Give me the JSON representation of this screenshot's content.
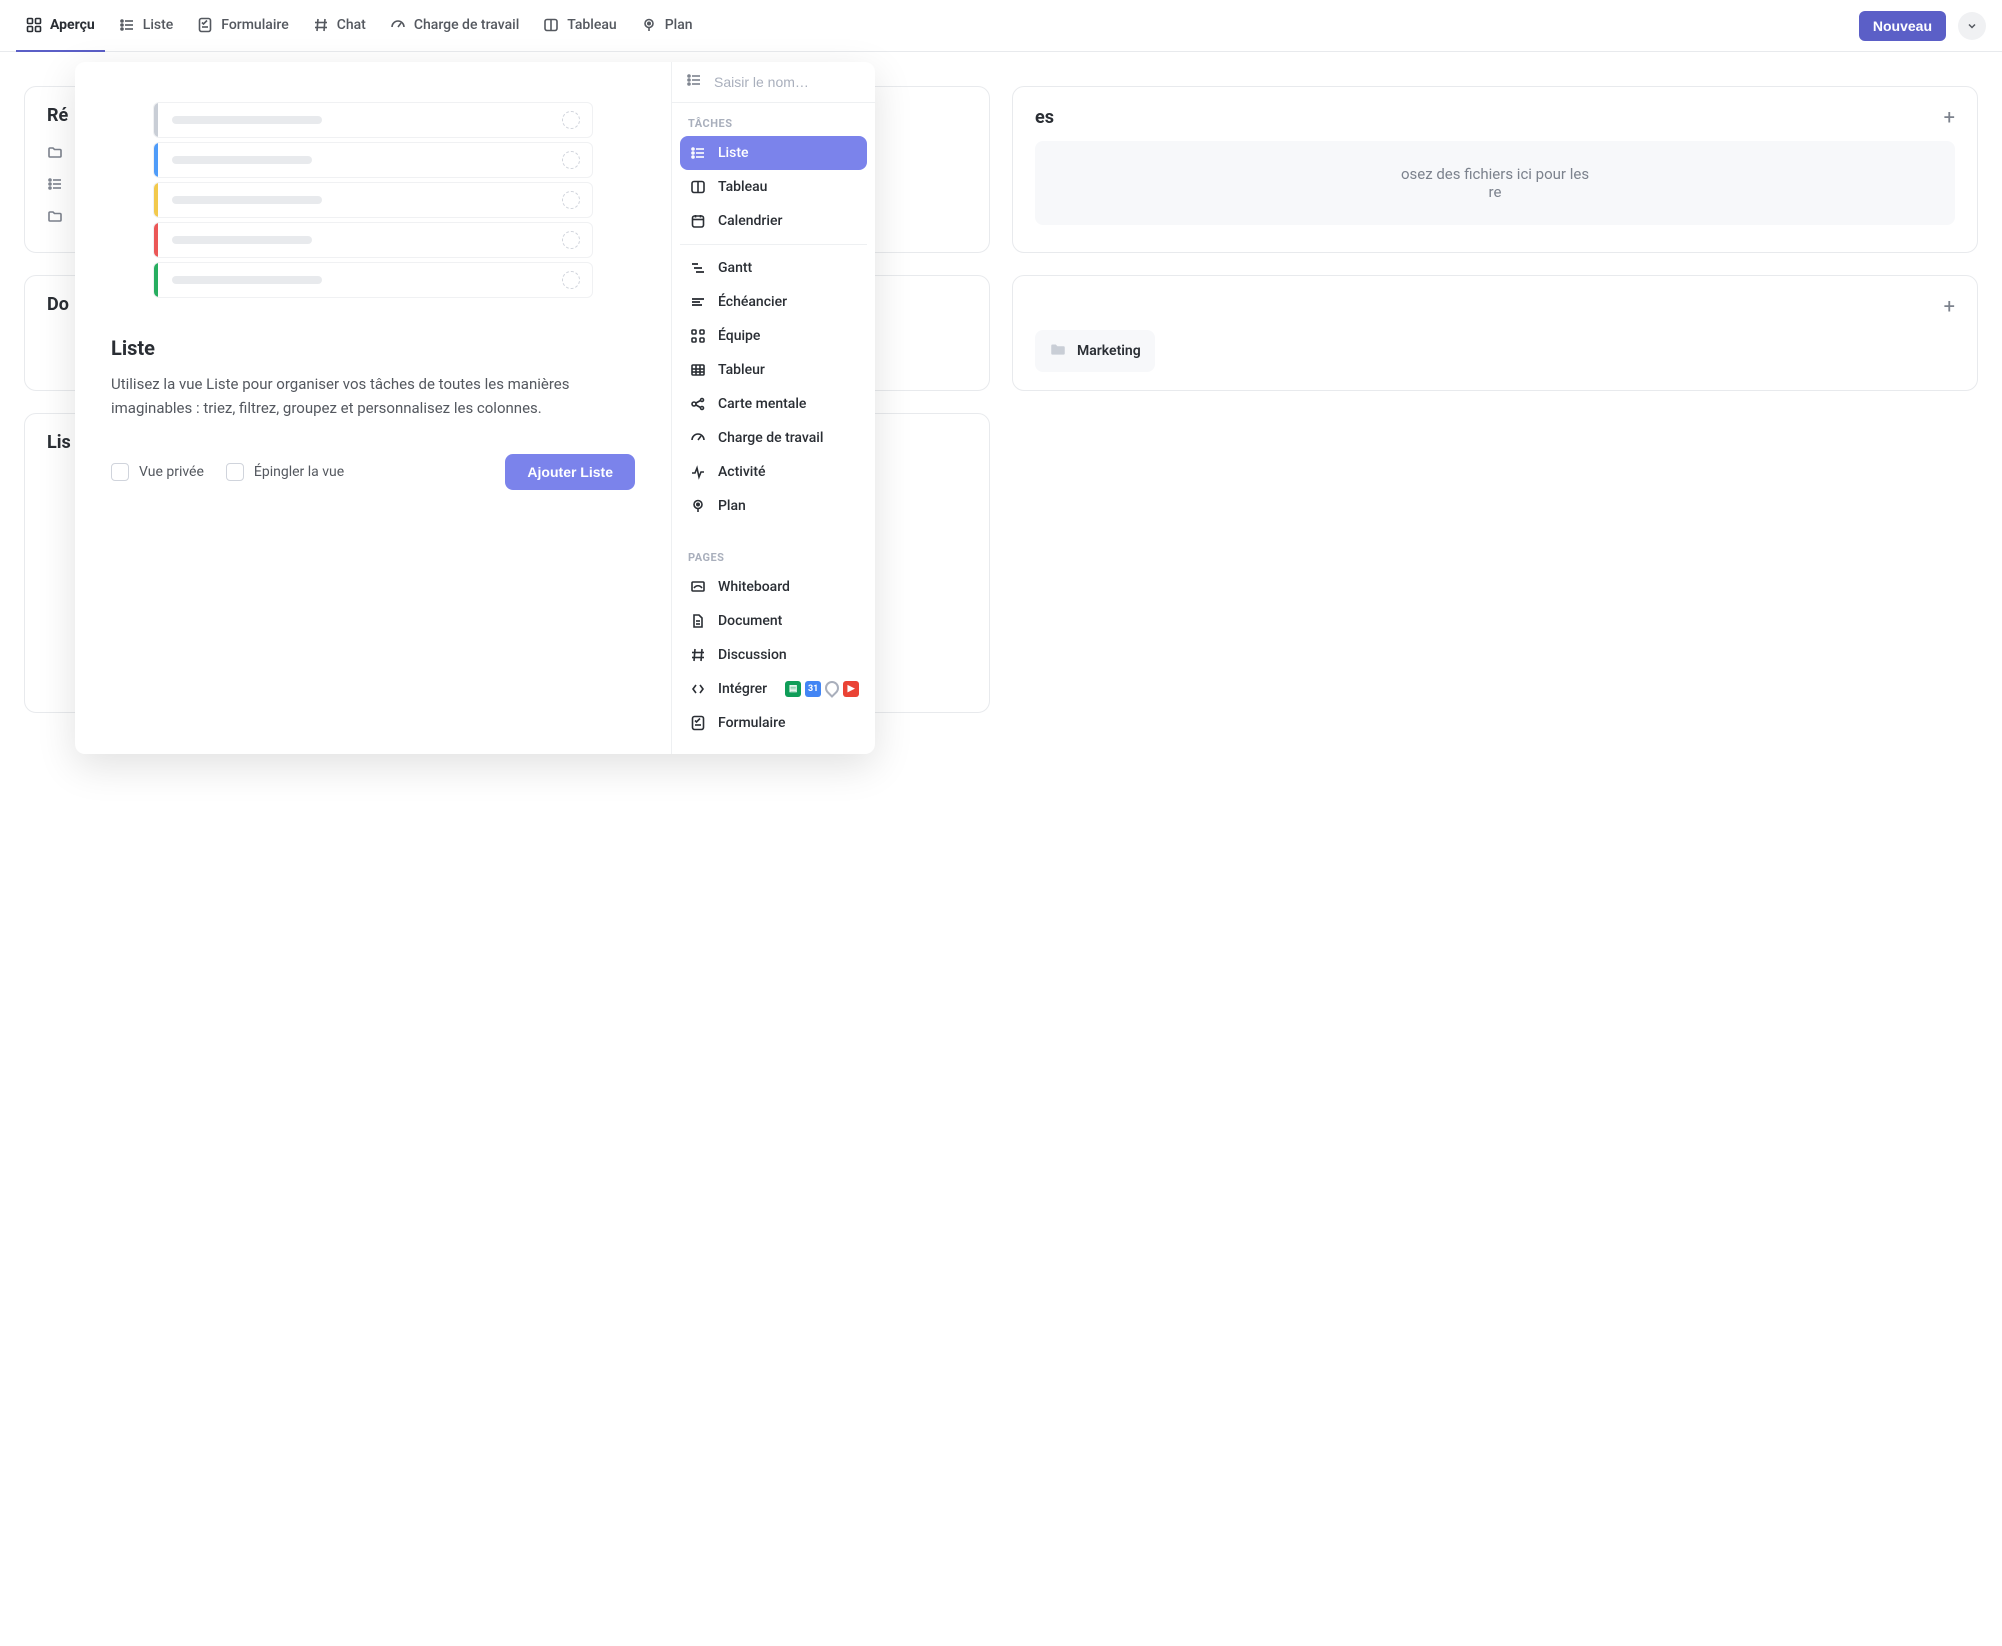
{
  "topbar": {
    "tabs": [
      {
        "label": "Aperçu",
        "icon": "grid"
      },
      {
        "label": "Liste",
        "icon": "list"
      },
      {
        "label": "Formulaire",
        "icon": "form"
      },
      {
        "label": "Chat",
        "icon": "hash"
      },
      {
        "label": "Charge de travail",
        "icon": "gauge"
      },
      {
        "label": "Tableau",
        "icon": "board"
      },
      {
        "label": "Plan",
        "icon": "pin"
      }
    ],
    "new_button": "Nouveau"
  },
  "cards": {
    "recent_title": "Ré",
    "docs_title": "Do",
    "lists_title": "Lis",
    "resources_title": "es",
    "dropzone_line1": "osez des fichiers ici pour les",
    "dropzone_line2": "re",
    "folder_card_item": "Marketing"
  },
  "overlay": {
    "title": "Liste",
    "description": "Utilisez la vue Liste pour organiser vos tâches de toutes les manières imaginables : triez, filtrez, groupez et personnalisez les colonnes.",
    "private_label": "Vue privée",
    "pin_label": "Épingler la vue",
    "add_button": "Ajouter Liste",
    "search_placeholder": "Saisir le nom…",
    "section_tasks": "Tâches",
    "section_pages": "Pages",
    "task_views": [
      {
        "label": "Liste"
      },
      {
        "label": "Tableau"
      },
      {
        "label": "Calendrier"
      },
      {
        "label": "Gantt"
      },
      {
        "label": "Échéancier"
      },
      {
        "label": "Équipe"
      },
      {
        "label": "Tableur"
      },
      {
        "label": "Carte mentale"
      },
      {
        "label": "Charge de travail"
      },
      {
        "label": "Activité"
      },
      {
        "label": "Plan"
      }
    ],
    "page_views": [
      {
        "label": "Whiteboard"
      },
      {
        "label": "Document"
      },
      {
        "label": "Discussion"
      },
      {
        "label": "Intégrer"
      },
      {
        "label": "Formulaire"
      }
    ]
  }
}
